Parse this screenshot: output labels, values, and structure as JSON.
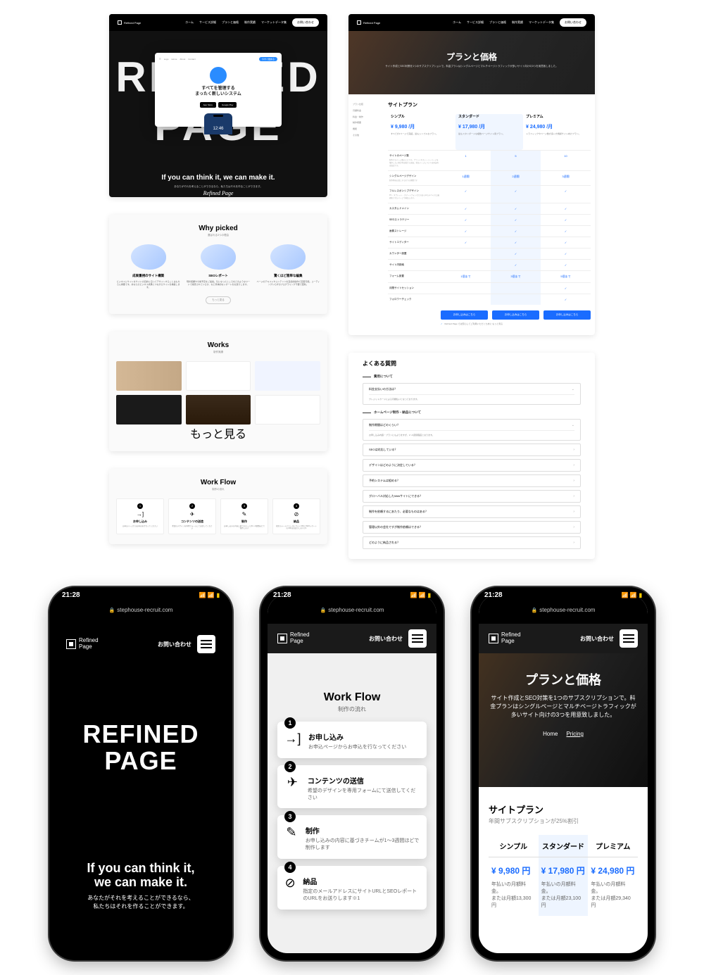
{
  "brand": {
    "name": "Refined Page",
    "short": "Refined\nPage"
  },
  "dnav": {
    "items": [
      "ホーム",
      "サービス詳細",
      "プランと価格",
      "制作実績",
      "マーケットデータ集"
    ],
    "cta": "お問い合わせ"
  },
  "hero": {
    "big1": "REFINED",
    "big2": "PAGE",
    "mock_title1": "すべてを管理する",
    "mock_title2": "まったく新しいシステム",
    "mock_btn1": "App Store",
    "mock_btn2": "Google Play",
    "mock_time": "12:46",
    "tagline": "If you can think it, we can make it.",
    "jp_tag": "あなたがそれを考えることができるなら、私たちはそれを作ることができます。",
    "script": "Refined Page"
  },
  "why": {
    "title": "Why picked",
    "sub": "選ばれる3つの理由",
    "more": "もっと見る",
    "cards": [
      {
        "title": "成果重視のサイト構築",
        "desc": "ビジネスにサイトをサイドの目的に沿ってデザインすることはもちろん重要です。あなたのビジネス成果につながるサイトを構築します。"
      },
      {
        "title": "SEOレポート",
        "desc": "現状把握や今後予定をご提案。気になったところをどのようなワードで検索されているか、など具体的なレポートをお送りします。"
      },
      {
        "title": "驚くほど簡単な編集",
        "desc": "ページのテキストやコンテンツを直感的操作で変更可能。コーディングいらずのプログラミング不要で更新。"
      }
    ]
  },
  "works": {
    "title": "Works",
    "sub": "制作実績",
    "more": "もっと見る"
  },
  "flow": {
    "title": "Work Flow",
    "sub": "制作の流れ",
    "steps": [
      {
        "n": "1",
        "icon": "→]",
        "title": "お申し込み",
        "desc": "お申込ページからお申込を行なってください"
      },
      {
        "n": "2",
        "icon": "✈",
        "title": "コンテンツの送信",
        "desc": "希望のデザインを専用フォームにて送信してください"
      },
      {
        "n": "3",
        "icon": "✎",
        "title": "制作",
        "desc": "お申し込みの内容に基づきチームが1〜3週間ほどで制作します"
      },
      {
        "n": "4",
        "icon": "⊘",
        "title": "納品",
        "desc": "指定のメールアドレスにサイトURLとSEOレポートのURLをお送りします※1"
      }
    ]
  },
  "pricing": {
    "banner_title": "プランと価格",
    "banner_desc": "サイト作成とSEO対策を1つのサブスクリプションで。料金プランはシングルページとマルチページトラフィックが多いサイト向けの3つを用意致しました。",
    "side": [
      "プラン比較",
      "月額料金",
      "料金・制作",
      "制作概要",
      "機能",
      "その他"
    ],
    "table_title": "サイトプラン",
    "cols": [
      {
        "name": "シンプル",
        "price": "¥ 9,980 /月",
        "desc": "すべてが1ページで完結。最もシンプルなプラン。"
      },
      {
        "name": "スタンダード",
        "price": "¥ 17,980 /月",
        "desc": "最もスタンダードな複数ページサイト用プラン。"
      },
      {
        "name": "プレミアム",
        "price": "¥ 24,980 /月",
        "desc": "トラフィックやページ数が多い大規模サイト向けプラン。"
      }
    ],
    "rows": [
      {
        "label": "サイトのページ数",
        "meta": "制作するページ数のことです。ブランドやストーリーページを増やしたい場合等は後から追加。単品ページについては目安料金設定です。",
        "cells": [
          "1",
          "5",
          "10"
        ]
      },
      {
        "label": "シングルページデザイン",
        "meta": "制作物をお渡しするまでの期間です",
        "cells": [
          "1週間",
          "2週間",
          "3週間"
        ]
      },
      {
        "label": "フルレスポンシブデザイン",
        "meta": "PC・タブレット・スマートフォンなどのあらゆるデバイスに最適化されたページで納品します。",
        "cells": [
          "✓",
          "✓",
          "✓"
        ]
      },
      {
        "label": "カスタムドメイン",
        "cells": [
          "✓",
          "✓",
          "✓"
        ]
      },
      {
        "label": "SEOストラテジー",
        "cells": [
          "✓",
          "✓",
          "✓"
        ]
      },
      {
        "label": "画像ストレージ",
        "cells": [
          "✓",
          "✓",
          "✓"
        ]
      },
      {
        "label": "サイトエディター",
        "cells": [
          "✓",
          "✓",
          "✓"
        ]
      },
      {
        "label": "カウンター設置",
        "cells": [
          "",
          "✓",
          "✓"
        ]
      },
      {
        "label": "サイト内検索",
        "cells": [
          "",
          "✓",
          "✓"
        ]
      },
      {
        "label": "フォーム設置",
        "cells": [
          "1個まで",
          "3個まで",
          "5個まで"
        ]
      },
      {
        "label": "月間サイトセッション",
        "cells": [
          "",
          "",
          "✓"
        ]
      },
      {
        "label": "フォロワーチェック",
        "cells": [
          "",
          "",
          "✓"
        ]
      }
    ],
    "btn": "お申し込みはこちら",
    "note": "Refined Page では安心してご利用いただくために もっと見る"
  },
  "faq": {
    "title": "よくある質問",
    "s1": "費用について",
    "s1_items": [
      {
        "q": "料金支払いの方法は？",
        "a": "クレジットカードによる月額払いとなっております。",
        "open": true
      }
    ],
    "s2": "ホームページ制作・納品について",
    "s2_items": [
      {
        "q": "制作期間はどのくらい？",
        "a": "お申し込み内容・プランにもよりますが、1〜3週間程度となります。",
        "open": true
      },
      {
        "q": "SEOは対応している？"
      },
      {
        "q": "デザインはどのように決定している？"
      },
      {
        "q": "予約システムは組める？"
      },
      {
        "q": "グローバル対応したWebサイトにできる？"
      },
      {
        "q": "制作を依頼するにあたり、必要なものはある？"
      },
      {
        "q": "管理以外の会社ですが制作依頼はできる？"
      },
      {
        "q": "どのように納品される？"
      }
    ]
  },
  "mobile": {
    "time": "21:28",
    "url": "stephouse-recruit.com",
    "cta": "お問い合わせ",
    "p3_breadcrumb": [
      "Home",
      "Pricing"
    ],
    "p3_section_title": "サイトプラン",
    "p3_section_note": "年間サブスクリプションが25%割引",
    "p3_cols": [
      {
        "name": "シンプル",
        "price": "¥ 9,980 円",
        "l1": "年払いの月額料金。",
        "l2": "または月額13,300円"
      },
      {
        "name": "スタンダード",
        "price": "¥ 17,980 円",
        "l1": "年払いの月額料金。",
        "l2": "または月額23,100円"
      },
      {
        "name": "プレミアム",
        "price": "¥ 24,980 円",
        "l1": "年払いの月額料金。",
        "l2": "または月額29,340円"
      }
    ]
  }
}
